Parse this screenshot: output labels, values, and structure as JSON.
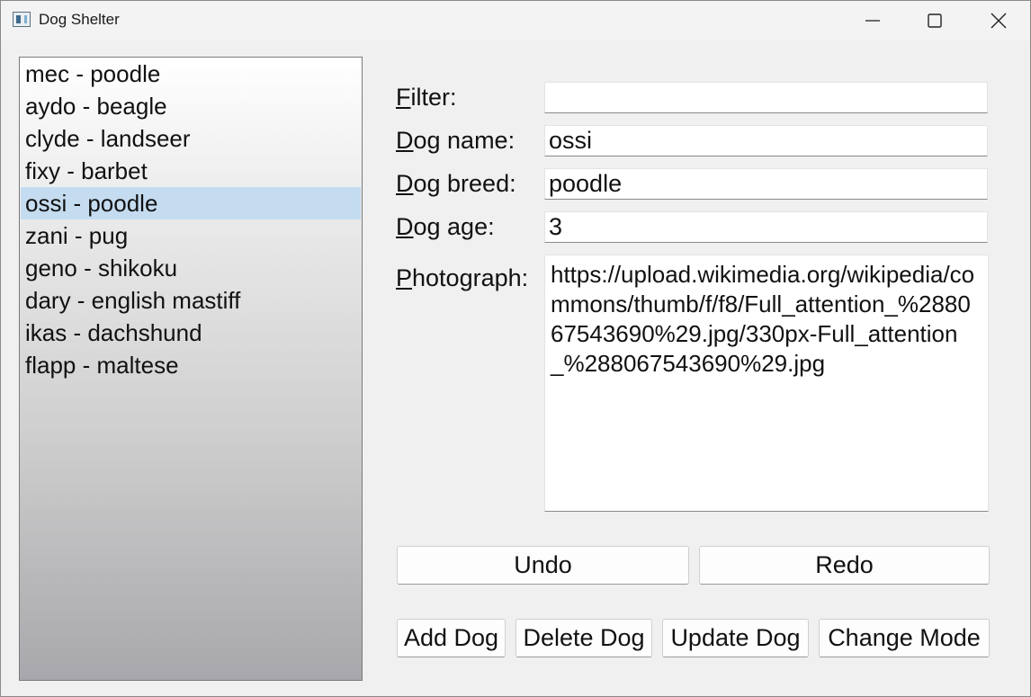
{
  "window": {
    "title": "Dog Shelter"
  },
  "dogs": [
    "mec - poodle",
    "aydo - beagle",
    "clyde - landseer",
    "fixy - barbet",
    "ossi - poodle",
    "zani - pug",
    "geno - shikoku",
    "dary - english mastiff",
    "ikas - dachshund",
    "flapp - maltese"
  ],
  "selected_index": 4,
  "form": {
    "filter": {
      "label_key": "F",
      "label_rest": "ilter:",
      "value": ""
    },
    "name": {
      "label_key": "D",
      "label_rest": "og name:",
      "value": "ossi"
    },
    "breed": {
      "label_key": "D",
      "label_rest": "og breed:",
      "value": "poodle"
    },
    "age": {
      "label_key": "D",
      "label_rest": "og age:",
      "value": "3"
    },
    "photo": {
      "label_key": "P",
      "label_rest": "hotograph:",
      "value": "https://upload.wikimedia.org/wikipedia/commons/thumb/f/f8/Full_attention_%288067543690%29.jpg/330px-Full_attention_%288067543690%29.jpg"
    }
  },
  "buttons": {
    "undo": "Undo",
    "redo": "Redo",
    "add": "Add Dog",
    "delete": "Delete Dog",
    "update": "Update Dog",
    "mode": "Change Mode"
  },
  "colors": {
    "selection": "#c5dcf0",
    "window_bg": "#f0f0f0"
  }
}
